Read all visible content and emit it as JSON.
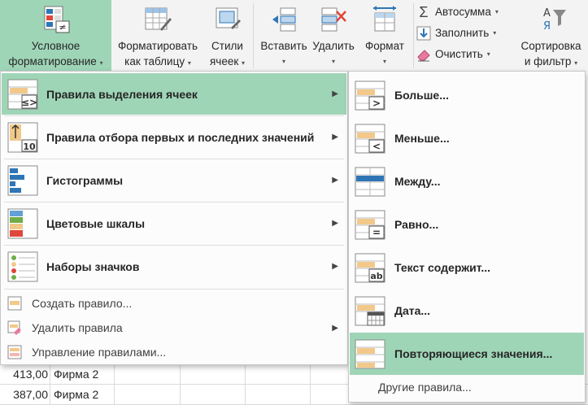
{
  "ribbon": {
    "conditional_formatting": {
      "line1": "Условное",
      "line2": "форматирование"
    },
    "format_as_table": {
      "line1": "Форматировать",
      "line2": "как таблицу"
    },
    "cell_styles": {
      "line1": "Стили",
      "line2": "ячеек"
    },
    "insert": "Вставить",
    "delete": "Удалить",
    "format": "Формат",
    "autosum": "Автосумма",
    "fill": "Заполнить",
    "clear": "Очистить",
    "sort_filter": {
      "line1": "Сортировка",
      "line2": "и фильтр"
    }
  },
  "menu": {
    "items": [
      {
        "label": "Правила выделения ячеек",
        "icon": "highlight-rules-icon"
      },
      {
        "label": "Правила отбора первых и последних значений",
        "icon": "top-bottom-rules-icon"
      },
      {
        "label": "Гистограммы",
        "icon": "data-bars-icon"
      },
      {
        "label": "Цветовые шкалы",
        "icon": "color-scales-icon"
      },
      {
        "label": "Наборы значков",
        "icon": "icon-sets-icon"
      }
    ],
    "small_items": [
      {
        "label": "Создать правило...",
        "icon": "new-rule-icon"
      },
      {
        "label": "Удалить правила",
        "icon": "clear-rules-icon"
      },
      {
        "label": "Управление правилами...",
        "icon": "manage-rules-icon"
      }
    ]
  },
  "submenu": {
    "items": [
      {
        "label": "Больше...",
        "icon": "greater-than-icon"
      },
      {
        "label": "Меньше...",
        "icon": "less-than-icon"
      },
      {
        "label": "Между...",
        "icon": "between-icon"
      },
      {
        "label": "Равно...",
        "icon": "equal-to-icon"
      },
      {
        "label": "Текст содержит...",
        "icon": "text-contains-icon"
      },
      {
        "label": "Дата...",
        "icon": "date-occurring-icon"
      },
      {
        "label": "Повторяющиеся значения...",
        "icon": "duplicate-values-icon"
      }
    ],
    "other": "Другие правила..."
  },
  "sheet": {
    "rows": [
      {
        "value": "413,00",
        "company": "Фирма 2"
      },
      {
        "value": "387,00",
        "company": "Фирма 2"
      }
    ]
  },
  "colors": {
    "highlight": "#9fd5b7",
    "ribbon_bg": "#f3f3f3",
    "icon_orange": "#f2c98a",
    "icon_blue": "#2e75b6",
    "icon_red": "#e0463a"
  }
}
